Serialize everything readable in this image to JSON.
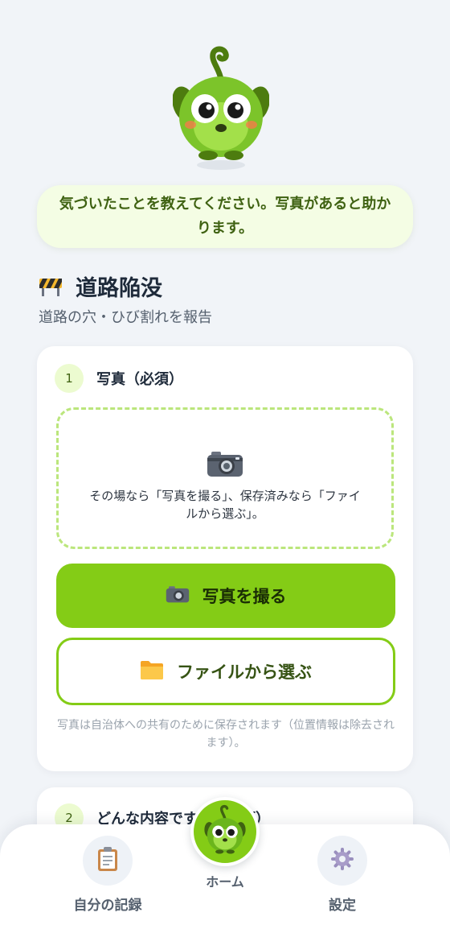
{
  "mascot": {
    "icon": "green-monster-mascot"
  },
  "speech": {
    "text": "気づいたことを教えてください。写真があると助かります。"
  },
  "category": {
    "icon": "road-barrier-icon",
    "title": "道路陥没",
    "subtitle": "道路の穴・ひび割れを報告"
  },
  "step1": {
    "number": "1",
    "label": "写真（必須）",
    "dropzone_text": "その場なら「写真を撮る」、保存済みなら「ファイルから選ぶ」。",
    "take_photo_label": "写真を撮る",
    "choose_file_label": "ファイルから選ぶ",
    "note": "写真は自治体への共有のために保存されます（位置情報は除去されます）。"
  },
  "step2": {
    "number": "2",
    "label": "どんな内容ですか（必須）"
  },
  "nav": {
    "records_label": "自分の記録",
    "home_label": "ホーム",
    "settings_label": "設定"
  },
  "colors": {
    "accent": "#84cc16",
    "accent_light": "#ecfbd0",
    "speech_bg": "#f4fde4",
    "background": "#f1f4f8"
  }
}
